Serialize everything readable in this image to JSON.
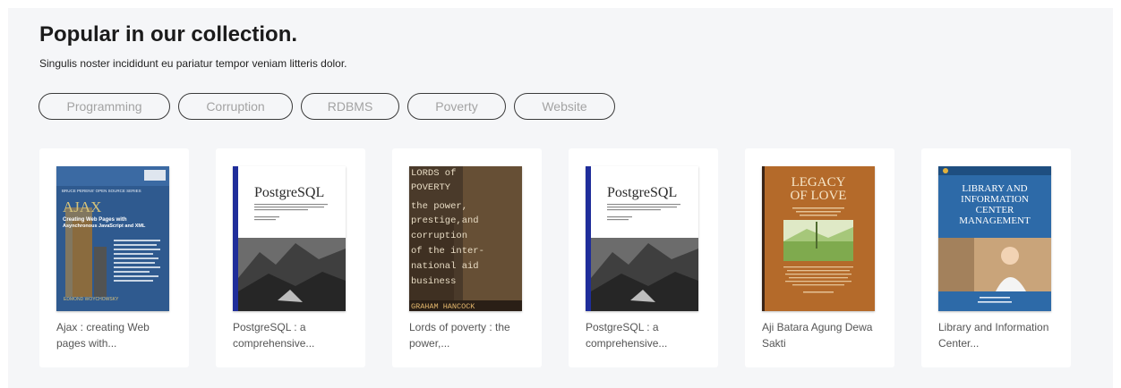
{
  "section": {
    "title": "Popular in our collection.",
    "subtitle": "Singulis noster incididunt eu pariatur tempor veniam litteris dolor."
  },
  "chips": [
    {
      "label": "Programming"
    },
    {
      "label": "Corruption"
    },
    {
      "label": "RDBMS"
    },
    {
      "label": "Poverty"
    },
    {
      "label": "Website"
    }
  ],
  "books": [
    {
      "title": "Ajax : creating Web pages with...",
      "cover": {
        "series": "BRUCE PERENS' OPEN SOURCE SERIES",
        "heading": "AJAX",
        "subtitle_line1": "Creating Web Pages with",
        "subtitle_line2": "Asynchronous JavaScript and XML",
        "author": "EDMOND WOYCHOWSKY"
      }
    },
    {
      "title": "PostgreSQL : a comprehensive...",
      "cover": {
        "heading": "PostgreSQL"
      }
    },
    {
      "title": "Lords of poverty : the power,...",
      "cover": {
        "lines": [
          "LORDS of",
          "POVERTY",
          "the power,",
          "prestige,and",
          "corruption",
          "of the inter-",
          "national aid",
          "business"
        ],
        "author": "GRAHAM HANCOCK"
      }
    },
    {
      "title": "PostgreSQL : a comprehensive...",
      "cover": {
        "heading": "PostgreSQL"
      }
    },
    {
      "title": "Aji Batara Agung Dewa Sakti",
      "cover": {
        "line1": "LEGACY",
        "line2": "OF LOVE"
      }
    },
    {
      "title": "Library and Information Center...",
      "cover": {
        "line1": "LIBRARY AND",
        "line2": "INFORMATION",
        "line3": "CENTER",
        "line4": "MANAGEMENT"
      }
    }
  ],
  "colors": {
    "section_bg": "#f5f6f8",
    "chip_border": "#3a3a3a",
    "chip_text": "#a3a3a3"
  }
}
